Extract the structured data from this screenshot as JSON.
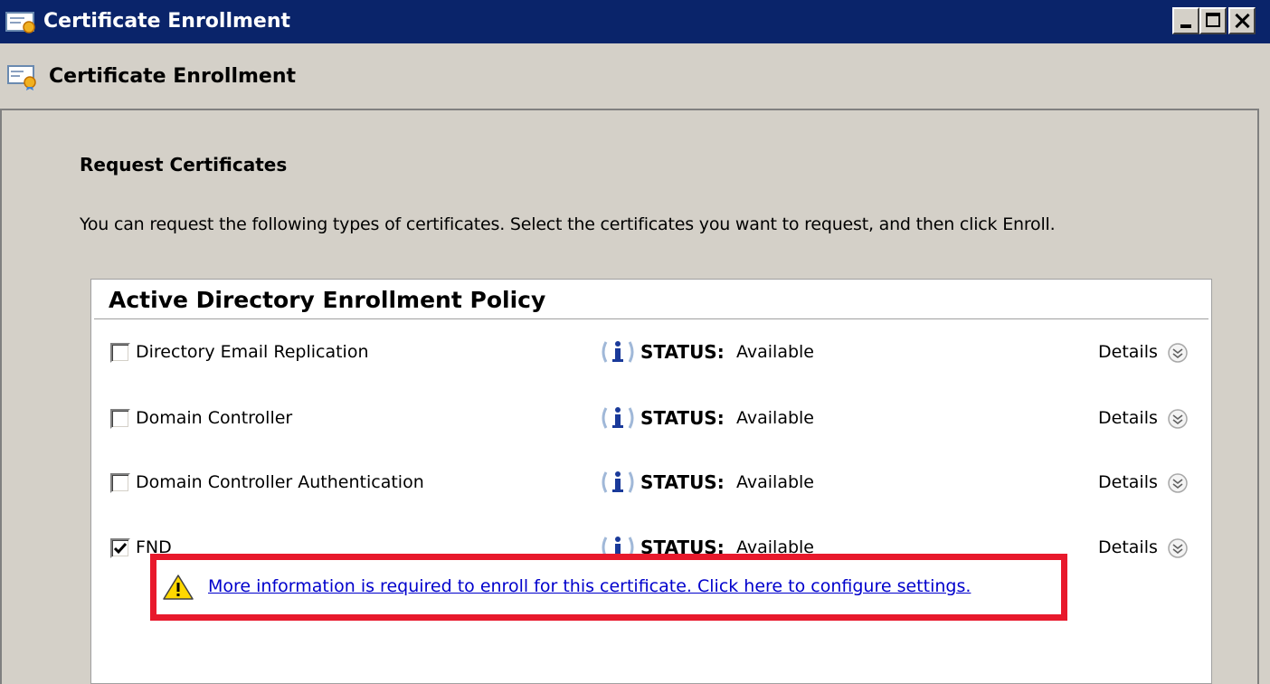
{
  "window": {
    "title": "Certificate Enrollment",
    "app_icon": "certificate-icon"
  },
  "header": {
    "title": "Certificate Enrollment",
    "icon": "certificate-icon"
  },
  "page": {
    "heading": "Request Certificates",
    "instructions": "You can request the following types of certificates. Select the certificates you want to request, and then click Enroll."
  },
  "policy": {
    "title": "Active Directory Enrollment Policy",
    "status_label": "STATUS:",
    "details_label": "Details",
    "certificates": [
      {
        "name": "Directory Email Replication",
        "checked": false,
        "status": "Available"
      },
      {
        "name": "Domain Controller",
        "checked": false,
        "status": "Available"
      },
      {
        "name": "Domain Controller Authentication",
        "checked": false,
        "status": "Available"
      },
      {
        "name": "FND",
        "checked": true,
        "status": "Available"
      }
    ],
    "warning": {
      "icon": "warning-icon",
      "text": "More information is required to enroll for this certificate. Click here to configure settings."
    }
  },
  "colors": {
    "titlebar": "#0a246a",
    "highlight": "#e8192c",
    "link": "#0000cc",
    "background": "#d4d0c8"
  }
}
